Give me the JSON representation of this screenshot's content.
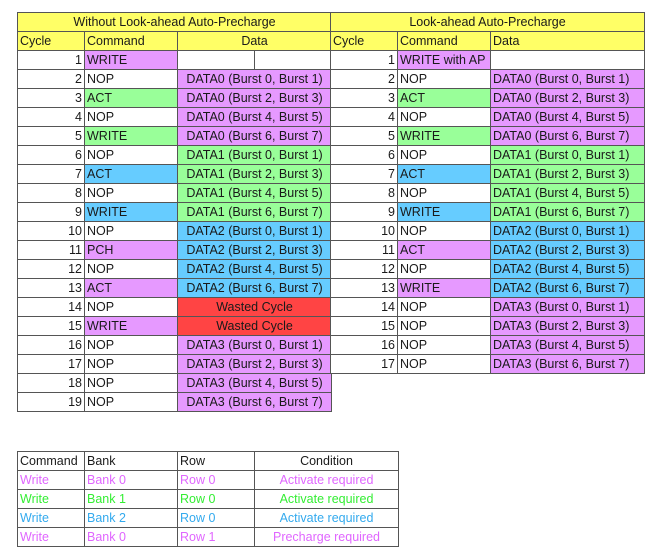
{
  "colors": {
    "header": "#ffff66",
    "purple": "#e699ff",
    "green": "#99ff99",
    "blue": "#66ccff",
    "red": "#ff4444"
  },
  "left_table": {
    "title": "Without Look-ahead Auto-Precharge",
    "headers": [
      "Cycle",
      "Command",
      "Data"
    ],
    "rows": [
      {
        "cycle": "1",
        "command": "WRITE",
        "command_color": "purple",
        "data": "",
        "data_color": "white",
        "data_split": true
      },
      {
        "cycle": "2",
        "command": "NOP",
        "command_color": "white",
        "data": "DATA0 (Burst 0, Burst 1)",
        "data_color": "purple"
      },
      {
        "cycle": "3",
        "command": "ACT",
        "command_color": "green",
        "data": "DATA0 (Burst 2, Burst 3)",
        "data_color": "purple"
      },
      {
        "cycle": "4",
        "command": "NOP",
        "command_color": "white",
        "data": "DATA0 (Burst 4, Burst 5)",
        "data_color": "purple"
      },
      {
        "cycle": "5",
        "command": "WRITE",
        "command_color": "green",
        "data": "DATA0 (Burst 6, Burst 7)",
        "data_color": "purple"
      },
      {
        "cycle": "6",
        "command": "NOP",
        "command_color": "white",
        "data": "DATA1 (Burst 0, Burst 1)",
        "data_color": "green"
      },
      {
        "cycle": "7",
        "command": "ACT",
        "command_color": "blue",
        "data": "DATA1 (Burst 2, Burst 3)",
        "data_color": "green"
      },
      {
        "cycle": "8",
        "command": "NOP",
        "command_color": "white",
        "data": "DATA1 (Burst 4, Burst 5)",
        "data_color": "green"
      },
      {
        "cycle": "9",
        "command": "WRITE",
        "command_color": "blue",
        "data": "DATA1 (Burst 6, Burst 7)",
        "data_color": "green"
      },
      {
        "cycle": "10",
        "command": "NOP",
        "command_color": "white",
        "data": "DATA2 (Burst 0, Burst 1)",
        "data_color": "blue"
      },
      {
        "cycle": "11",
        "command": "PCH",
        "command_color": "purple",
        "data": "DATA2 (Burst 2, Burst 3)",
        "data_color": "blue"
      },
      {
        "cycle": "12",
        "command": "NOP",
        "command_color": "white",
        "data": "DATA2 (Burst 4, Burst 5)",
        "data_color": "blue"
      },
      {
        "cycle": "13",
        "command": "ACT",
        "command_color": "purple",
        "data": "DATA2 (Burst 6, Burst 7)",
        "data_color": "blue"
      },
      {
        "cycle": "14",
        "command": "NOP",
        "command_color": "white",
        "data": "Wasted Cycle",
        "data_color": "red"
      },
      {
        "cycle": "15",
        "command": "WRITE",
        "command_color": "purple",
        "data": "Wasted Cycle",
        "data_color": "red"
      },
      {
        "cycle": "16",
        "command": "NOP",
        "command_color": "white",
        "data": "DATA3 (Burst 0, Burst 1)",
        "data_color": "purple"
      },
      {
        "cycle": "17",
        "command": "NOP",
        "command_color": "white",
        "data": "DATA3 (Burst 2, Burst 3)",
        "data_color": "purple"
      },
      {
        "cycle": "18",
        "command": "NOP",
        "command_color": "white",
        "data": "DATA3 (Burst 4, Burst 5)",
        "data_color": "purple"
      },
      {
        "cycle": "19",
        "command": "NOP",
        "command_color": "white",
        "data": "DATA3 (Burst 6, Burst 7)",
        "data_color": "purple"
      }
    ]
  },
  "right_table": {
    "title": "Look-ahead Auto-Precharge",
    "headers": [
      "Cycle",
      "Command",
      "Data"
    ],
    "rows": [
      {
        "cycle": "1",
        "command": "WRITE with AP",
        "command_color": "purple",
        "data": "",
        "data_color": "white"
      },
      {
        "cycle": "2",
        "command": "NOP",
        "command_color": "white",
        "data": "DATA0 (Burst 0, Burst 1)",
        "data_color": "purple"
      },
      {
        "cycle": "3",
        "command": "ACT",
        "command_color": "green",
        "data": "DATA0 (Burst 2, Burst 3)",
        "data_color": "purple"
      },
      {
        "cycle": "4",
        "command": "NOP",
        "command_color": "white",
        "data": "DATA0 (Burst 4, Burst 5)",
        "data_color": "purple"
      },
      {
        "cycle": "5",
        "command": "WRITE",
        "command_color": "green",
        "data": "DATA0 (Burst 6, Burst 7)",
        "data_color": "purple"
      },
      {
        "cycle": "6",
        "command": "NOP",
        "command_color": "white",
        "data": "DATA1 (Burst 0, Burst 1)",
        "data_color": "green"
      },
      {
        "cycle": "7",
        "command": "ACT",
        "command_color": "blue",
        "data": "DATA1 (Burst 2, Burst 3)",
        "data_color": "green"
      },
      {
        "cycle": "8",
        "command": "NOP",
        "command_color": "white",
        "data": "DATA1 (Burst 4, Burst 5)",
        "data_color": "green"
      },
      {
        "cycle": "9",
        "command": "WRITE",
        "command_color": "blue",
        "data": "DATA1 (Burst 6, Burst 7)",
        "data_color": "green"
      },
      {
        "cycle": "10",
        "command": "NOP",
        "command_color": "white",
        "data": "DATA2 (Burst 0, Burst 1)",
        "data_color": "blue"
      },
      {
        "cycle": "11",
        "command": "ACT",
        "command_color": "purple",
        "data": "DATA2 (Burst 2, Burst 3)",
        "data_color": "blue"
      },
      {
        "cycle": "12",
        "command": "NOP",
        "command_color": "white",
        "data": "DATA2 (Burst 4, Burst 5)",
        "data_color": "blue"
      },
      {
        "cycle": "13",
        "command": "WRITE",
        "command_color": "purple",
        "data": "DATA2 (Burst 6, Burst 7)",
        "data_color": "blue"
      },
      {
        "cycle": "14",
        "command": "NOP",
        "command_color": "white",
        "data": "DATA3 (Burst 0, Burst 1)",
        "data_color": "purple"
      },
      {
        "cycle": "15",
        "command": "NOP",
        "command_color": "white",
        "data": "DATA3 (Burst 2, Burst 3)",
        "data_color": "purple"
      },
      {
        "cycle": "16",
        "command": "NOP",
        "command_color": "white",
        "data": "DATA3 (Burst 4, Burst 5)",
        "data_color": "purple"
      },
      {
        "cycle": "17",
        "command": "NOP",
        "command_color": "white",
        "data": "DATA3 (Burst 6, Burst 7)",
        "data_color": "purple"
      }
    ]
  },
  "legend_table": {
    "headers": [
      "Command",
      "Bank",
      "Row",
      "Condition"
    ],
    "rows": [
      {
        "command": "Write",
        "bank": "Bank 0",
        "row": "Row 0",
        "condition": "Activate required",
        "color": "purple"
      },
      {
        "command": "Write",
        "bank": "Bank 1",
        "row": "Row 0",
        "condition": "Activate required",
        "color": "green"
      },
      {
        "command": "Write",
        "bank": "Bank 2",
        "row": "Row 0",
        "condition": "Activate required",
        "color": "blue"
      },
      {
        "command": "Write",
        "bank": "Bank 0",
        "row": "Row 1",
        "condition": "Precharge required",
        "color": "purple"
      }
    ]
  }
}
